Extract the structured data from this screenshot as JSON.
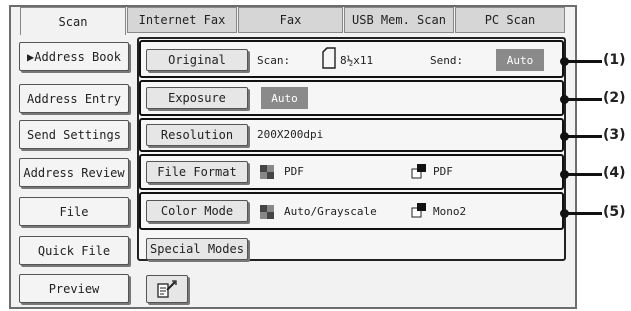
{
  "tabs": [
    {
      "label": "Scan",
      "active": true
    },
    {
      "label": "Internet Fax",
      "active": false
    },
    {
      "label": "Fax",
      "active": false
    },
    {
      "label": "USB Mem. Scan",
      "active": false
    },
    {
      "label": "PC Scan",
      "active": false
    }
  ],
  "left_menu": {
    "address_book": "▶Address Book",
    "address_entry": "Address Entry",
    "send_settings": "Send Settings",
    "address_review": "Address Review",
    "file": "File",
    "quick_file": "Quick File",
    "preview": "Preview"
  },
  "settings": {
    "original": {
      "button": "Original",
      "scan_label": "Scan:",
      "scan_value": "8½x11",
      "send_label": "Send:",
      "send_value": "Auto"
    },
    "exposure": {
      "button": "Exposure",
      "value": "Auto"
    },
    "resolution": {
      "button": "Resolution",
      "value": "200X200dpi"
    },
    "file_format": {
      "button": "File Format",
      "value1": "PDF",
      "value2": "PDF"
    },
    "color_mode": {
      "button": "Color Mode",
      "value1": "Auto/Grayscale",
      "value2": "Mono2"
    },
    "special_modes": {
      "button": "Special Modes"
    }
  },
  "callouts": [
    "(1)",
    "(2)",
    "(3)",
    "(4)",
    "(5)"
  ],
  "colors": {
    "accent_gray": "#8a8a8a",
    "frame": "#6d6d6d"
  },
  "icons": [
    "paper-size-icon",
    "color-grid-icon",
    "mono-page-icon",
    "edit-icon"
  ]
}
